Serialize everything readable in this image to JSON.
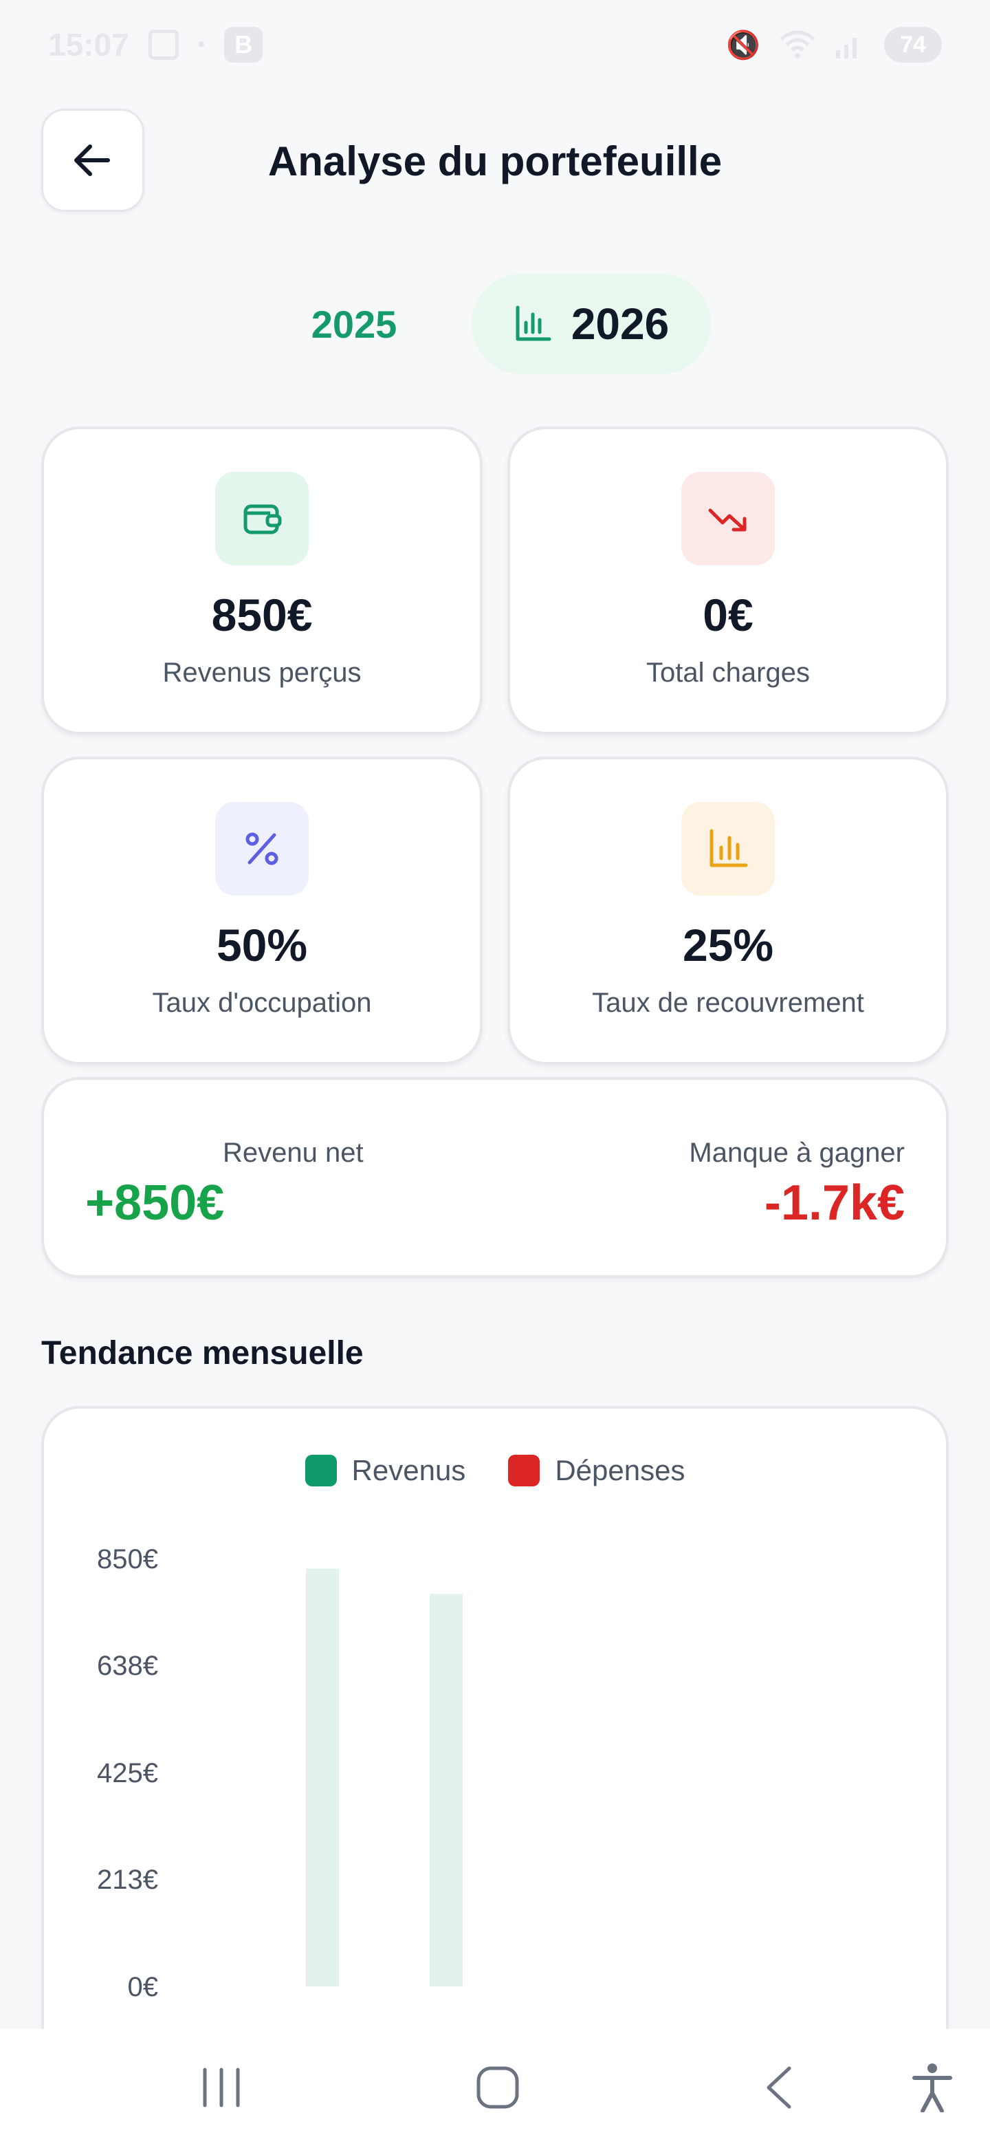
{
  "status_bar": {
    "time": "15:07",
    "battery": "74"
  },
  "header": {
    "title": "Analyse du portefeuille"
  },
  "years": {
    "prev": "2025",
    "current": "2026"
  },
  "stats": [
    {
      "value": "850€",
      "label": "Revenus perçus",
      "icon": "wallet-icon",
      "color": "#159a6b",
      "bg": "#e3f6ec"
    },
    {
      "value": "0€",
      "label": "Total charges",
      "icon": "trending-down-icon",
      "color": "#dc2626",
      "bg": "#fde8e8"
    },
    {
      "value": "50%",
      "label": "Taux d'occupation",
      "icon": "percent-icon",
      "color": "#5b5fe0",
      "bg": "#eef0fe"
    },
    {
      "value": "25%",
      "label": "Taux de recouvrement",
      "icon": "bar-chart-icon",
      "color": "#e8a317",
      "bg": "#fef3e2"
    }
  ],
  "net": {
    "revenue_label": "Revenu net",
    "revenue_value": "+850€",
    "shortfall_label": "Manque à gagner",
    "shortfall_value": "-1.7k€"
  },
  "section": {
    "trend_title": "Tendance mensuelle"
  },
  "chart_data": {
    "type": "bar",
    "title": "",
    "xlabel": "",
    "ylabel": "",
    "ylim": [
      0,
      850
    ],
    "y_ticks": [
      "850€",
      "638€",
      "425€",
      "213€",
      "0€"
    ],
    "y_tick_values": [
      850,
      638,
      425,
      213,
      0
    ],
    "categories": [
      "",
      "",
      "",
      "",
      "",
      "",
      "",
      "",
      "",
      "",
      "",
      ""
    ],
    "grid": false,
    "legend_position": "top-center",
    "series": [
      {
        "name": "Revenus",
        "color": "#0e9a6a",
        "bar_color": "#e3f3ec",
        "values": [
          0,
          0,
          830,
          0,
          780,
          0,
          0,
          0,
          0,
          0,
          0,
          0
        ]
      },
      {
        "name": "Dépenses",
        "color": "#dc2626",
        "bar_color": "#fde4e4",
        "values": [
          0,
          0,
          0,
          0,
          0,
          0,
          0,
          0,
          0,
          0,
          0,
          0
        ]
      }
    ]
  }
}
